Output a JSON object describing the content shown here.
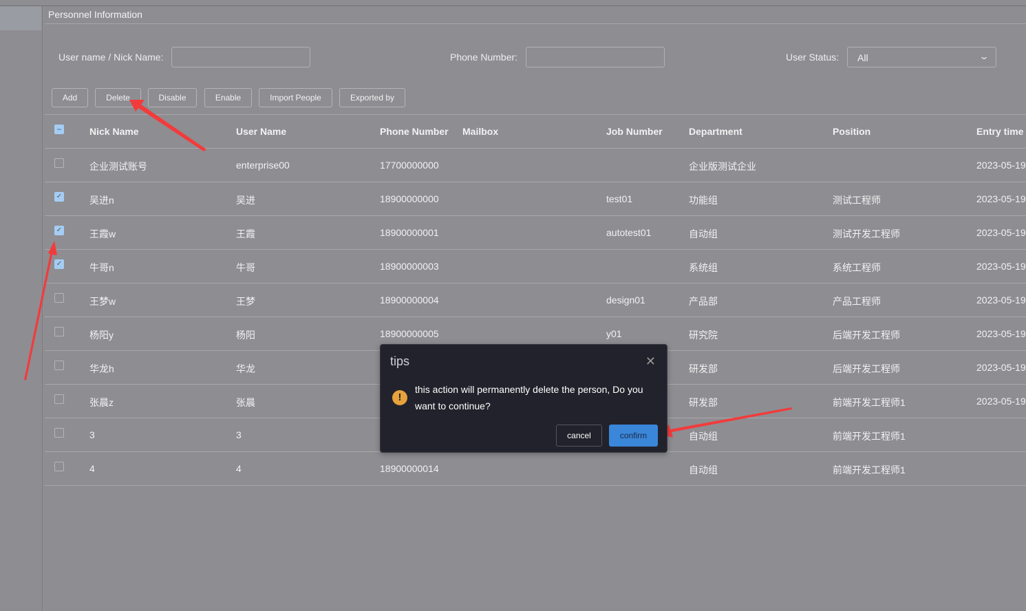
{
  "page_title": "Personnel Information",
  "filters": {
    "username_label": "User name / Nick Name:",
    "username_value": "",
    "phone_label": "Phone Number:",
    "phone_value": "",
    "status_label": "User Status:",
    "status_value": "All"
  },
  "toolbar": [
    "Add",
    "Delete",
    "Disable",
    "Enable",
    "Import People",
    "Exported by"
  ],
  "table": {
    "columns": [
      "Nick Name",
      "User Name",
      "Phone Number",
      "Mailbox",
      "Job Number",
      "Department",
      "Position",
      "Entry time"
    ],
    "header_checkbox": "indeterminate",
    "rows": [
      {
        "checked": false,
        "cells": [
          "企业测试账号",
          "enterprise00",
          "17700000000",
          "",
          "",
          "企业版测试企业",
          "",
          "2023-05-19"
        ]
      },
      {
        "checked": true,
        "cells": [
          "吴进n",
          "吴进",
          "18900000000",
          "",
          "test01",
          "功能组",
          "测试工程师",
          "2023-05-19"
        ]
      },
      {
        "checked": true,
        "cells": [
          "王霞w",
          "王霞",
          "18900000001",
          "",
          "autotest01",
          "自动组",
          "测试开发工程师",
          "2023-05-19"
        ]
      },
      {
        "checked": true,
        "cells": [
          "牛哥n",
          "牛哥",
          "18900000003",
          "",
          "",
          "系统组",
          "系统工程师",
          "2023-05-19"
        ]
      },
      {
        "checked": false,
        "cells": [
          "王梦w",
          "王梦",
          "18900000004",
          "",
          "design01",
          "产品部",
          "产品工程师",
          "2023-05-19"
        ]
      },
      {
        "checked": false,
        "cells": [
          "杨阳y",
          "杨阳",
          "18900000005",
          "",
          "y01",
          "研究院",
          "后端开发工程师",
          "2023-05-19"
        ]
      },
      {
        "checked": false,
        "cells": [
          "华龙h",
          "华龙",
          "",
          "",
          "",
          "研发部",
          "后端开发工程师",
          "2023-05-19"
        ]
      },
      {
        "checked": false,
        "cells": [
          "张晨z",
          "张晨",
          "",
          "",
          "",
          "研发部",
          "前端开发工程师1",
          "2023-05-19"
        ]
      },
      {
        "checked": false,
        "cells": [
          "3",
          "3",
          "",
          "",
          "",
          "自动组",
          "前端开发工程师1",
          ""
        ]
      },
      {
        "checked": false,
        "cells": [
          "4",
          "4",
          "18900000014",
          "",
          "",
          "自动组",
          "前端开发工程师1",
          ""
        ]
      }
    ]
  },
  "dialog": {
    "title": "tips",
    "message": "this action will permanently delete the person, Do you want to continue?",
    "cancel": "cancel",
    "confirm": "confirm",
    "icon": "warning-icon",
    "close_icon": "close-icon"
  },
  "colors": {
    "background": "#8e8d92",
    "dialog_bg": "#22222c",
    "confirm_blue": "#3a86d9",
    "warning": "#e6a23c",
    "annotation_arrow": "#f23b3b"
  }
}
